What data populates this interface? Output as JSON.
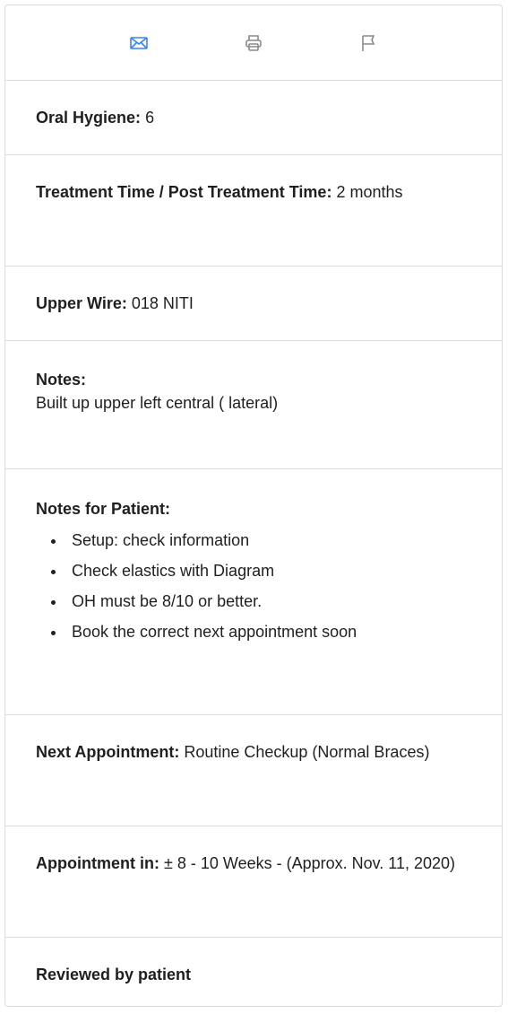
{
  "toolbar": {
    "icons": [
      "envelope-icon",
      "printer-icon",
      "flag-icon"
    ],
    "accent": "#3b82f6",
    "icon_color": "#8a8a8a"
  },
  "oral_hygiene": {
    "label": "Oral Hygiene:",
    "value": "6"
  },
  "treatment_time": {
    "label": "Treatment Time / Post Treatment Time:",
    "value": "2 months"
  },
  "upper_wire": {
    "label": "Upper Wire:",
    "value": "018 NITI"
  },
  "notes": {
    "label": "Notes:",
    "value": "Built up upper left central ( lateral)"
  },
  "notes_for_patient": {
    "label": "Notes for Patient:",
    "items": [
      "Setup: check information",
      "Check elastics with Diagram",
      "OH must be 8/10 or better.",
      "Book the correct next appointment soon"
    ]
  },
  "next_appointment": {
    "label": "Next Appointment:",
    "value": "Routine Checkup (Normal Braces)"
  },
  "appointment_in": {
    "label": "Appointment in:",
    "value": "± 8 - 10 Weeks - (Approx. Nov. 11, 2020)"
  },
  "reviewed": {
    "label": "Reviewed by patient"
  }
}
